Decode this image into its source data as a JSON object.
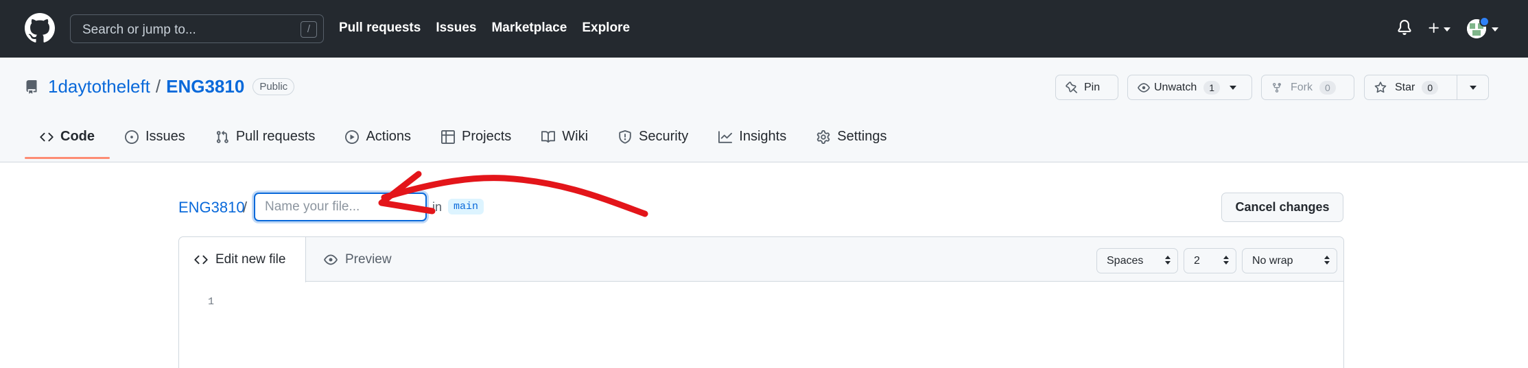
{
  "header": {
    "search_placeholder": "Search or jump to...",
    "search_shortcut": "/",
    "nav": [
      "Pull requests",
      "Issues",
      "Marketplace",
      "Explore"
    ]
  },
  "repo": {
    "owner": "1daytotheleft",
    "separator": "/",
    "name": "ENG3810",
    "visibility": "Public",
    "buttons": {
      "pin": "Pin",
      "unwatch": "Unwatch",
      "unwatch_count": "1",
      "fork": "Fork",
      "fork_count": "0",
      "star": "Star",
      "star_count": "0"
    },
    "tabs": [
      {
        "label": "Code",
        "icon": "code-icon",
        "active": true
      },
      {
        "label": "Issues",
        "icon": "issue-icon"
      },
      {
        "label": "Pull requests",
        "icon": "pull-request-icon"
      },
      {
        "label": "Actions",
        "icon": "play-icon"
      },
      {
        "label": "Projects",
        "icon": "table-icon"
      },
      {
        "label": "Wiki",
        "icon": "book-icon"
      },
      {
        "label": "Security",
        "icon": "shield-icon"
      },
      {
        "label": "Insights",
        "icon": "graph-icon"
      },
      {
        "label": "Settings",
        "icon": "gear-icon"
      }
    ]
  },
  "editor": {
    "breadcrumb_repo": "ENG3810",
    "breadcrumb_sep": "/",
    "filename_placeholder": "Name your file...",
    "filename_value": "",
    "in_label": "in",
    "branch": "main",
    "cancel_label": "Cancel changes",
    "tab_edit": "Edit new file",
    "tab_preview": "Preview",
    "indent_mode": "Spaces",
    "indent_size": "2",
    "wrap_mode": "No wrap",
    "line_numbers": [
      "1"
    ]
  },
  "colors": {
    "header_bg": "#24292f",
    "link": "#0969da",
    "active_tab_underline": "#fd8c73",
    "annotation_arrow": "#e3151a"
  }
}
